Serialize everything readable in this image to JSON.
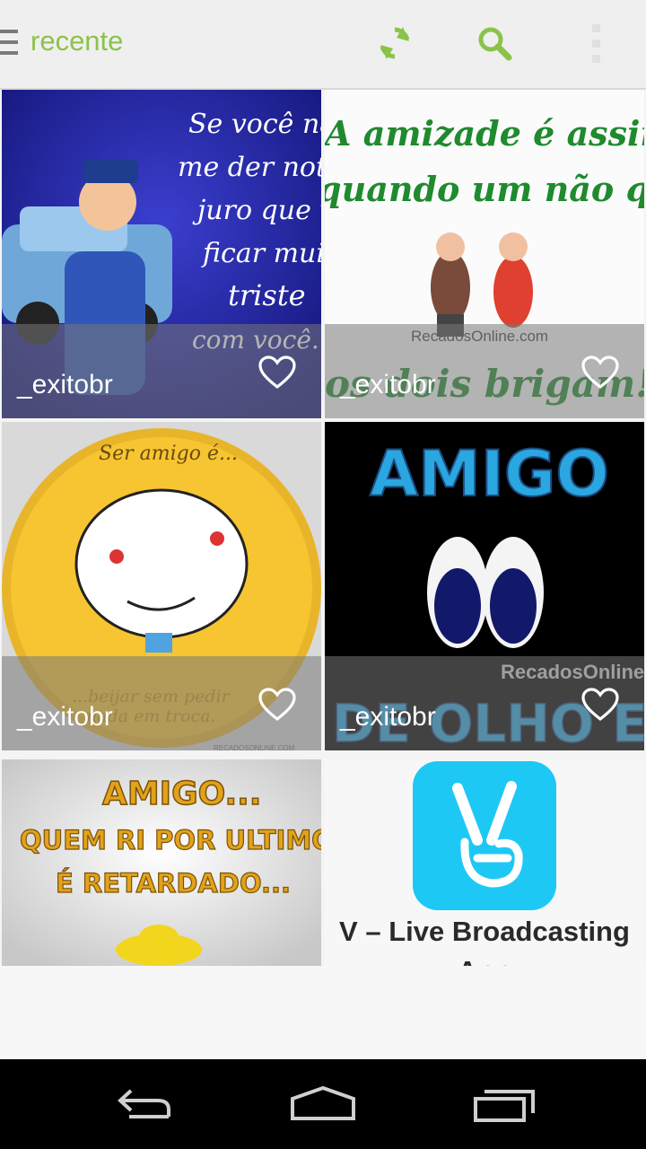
{
  "toolbar": {
    "title": "recente",
    "menu_icon": "hamburger-icon",
    "refresh_icon": "refresh-icon",
    "search_icon": "search-icon",
    "overflow_icon": "overflow-menu-icon",
    "accent_color": "#8bc34a"
  },
  "posts": [
    {
      "user": "_exitobr",
      "image_text": "Se você não me der notícia juro que vou ficar muito triste com você...",
      "liked": false
    },
    {
      "user": "_exitobr",
      "image_text": "A amizade é assim: quando um não quer, os dois brigam!!!",
      "watermark": "RecadosOnline.com",
      "liked": false
    },
    {
      "user": "_exitobr",
      "image_text_top": "Ser amigo é...",
      "image_text_bottom": "...beijar sem pedir nada em troca.",
      "watermark": "RECADOSONLINE.COM",
      "liked": false
    },
    {
      "user": "_exitobr",
      "image_text_top": "AMIGO",
      "image_text_bottom": "DE OLHO EM V",
      "watermark": "RecadosOnline",
      "liked": false
    },
    {
      "image_text": "AMIGO... QUEM RI POR ULTIMO É RETARDADO..."
    }
  ],
  "ad": {
    "title_line1": "V – Live Broadcasting",
    "title_line2": "App",
    "icon": "v-live-app-icon",
    "icon_color": "#1ec8f5"
  },
  "navigation": {
    "back_icon": "back-icon",
    "home_icon": "home-icon",
    "recents_icon": "recents-icon"
  }
}
